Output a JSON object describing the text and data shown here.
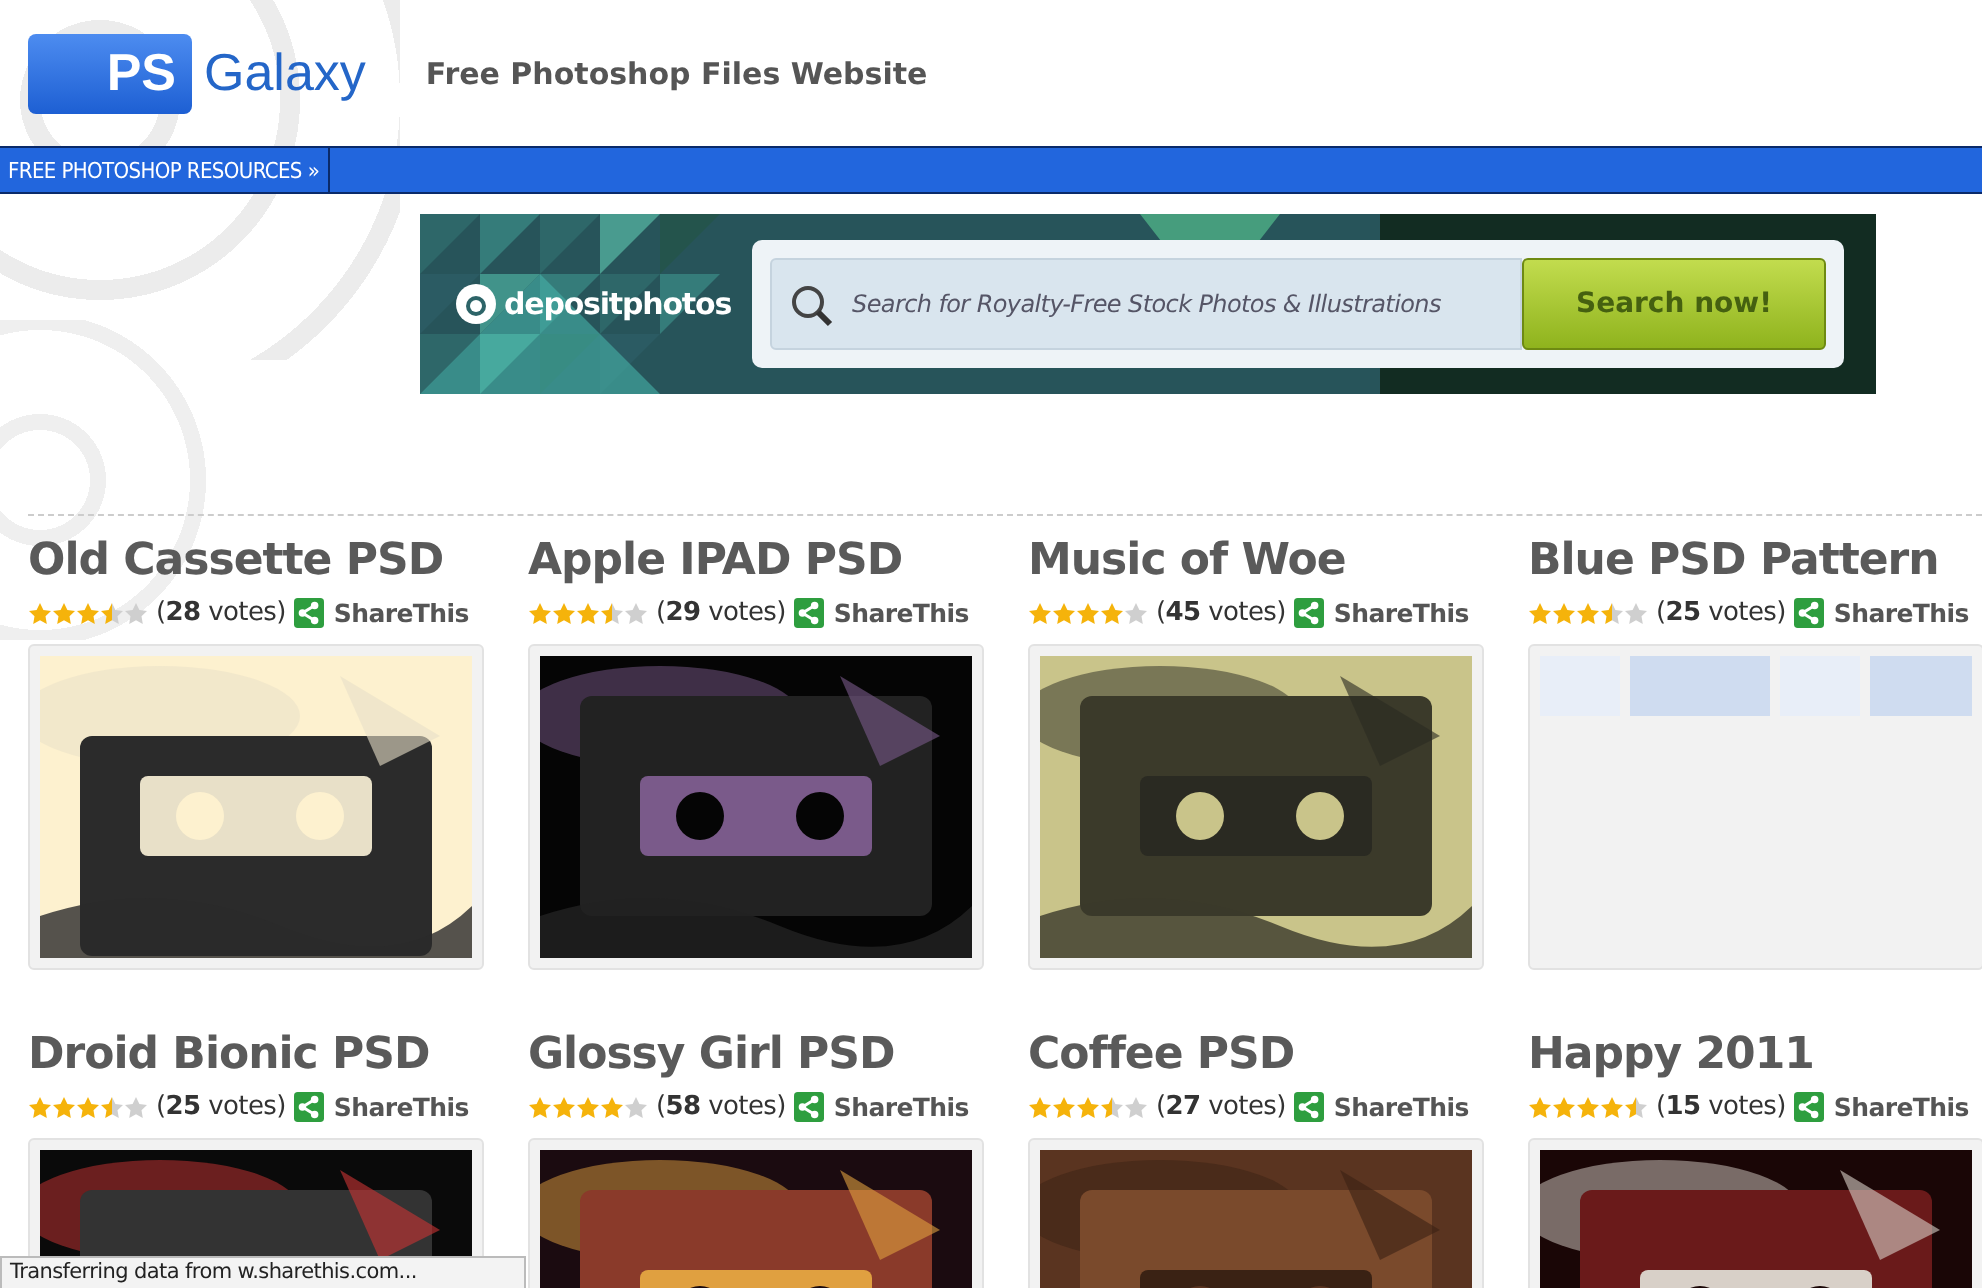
{
  "header": {
    "logo_badge": "PS",
    "logo_word": "Galaxy",
    "tagline": "Free Photoshop Files Website"
  },
  "nav": {
    "items": [
      {
        "label": "FREE PHOTOSHOP RESOURCES",
        "caret": "»"
      }
    ]
  },
  "banner": {
    "brand": "depositphotos",
    "search": {
      "placeholder": "Search for Royalty-Free Stock Photos & Illustrations"
    },
    "button": "Search now!"
  },
  "items": [
    {
      "title": "Old Cassette PSD",
      "stars": 3.5,
      "votes": "(**28** votes)",
      "share": "ShareThis"
    },
    {
      "title": "Apple IPAD PSD",
      "stars": 3.5,
      "votes": "(**29** votes)",
      "share": "ShareThis"
    },
    {
      "title": "Music of Woe",
      "stars": 4,
      "votes": "(**45** votes)",
      "share": "ShareThis"
    },
    {
      "title": "Blue PSD Pattern",
      "stars": 3.5,
      "votes": "(**25** votes)",
      "share": "ShareThis"
    },
    {
      "title": "Droid Bionic PSD",
      "stars": 3.5,
      "votes": "(**25** votes)",
      "share": "ShareThis"
    },
    {
      "title": "Glossy Girl PSD",
      "stars": 4,
      "votes": "(**58** votes)",
      "share": "ShareThis"
    },
    {
      "title": "Coffee PSD",
      "stars": 3.5,
      "votes": "(**27** votes)",
      "share": "ShareThis"
    },
    {
      "title": "Happy 2011",
      "stars": 4.5,
      "votes": "(**15** votes)",
      "share": "ShareThis"
    }
  ],
  "status_bar": "Transferring data from w.sharethis.com..."
}
